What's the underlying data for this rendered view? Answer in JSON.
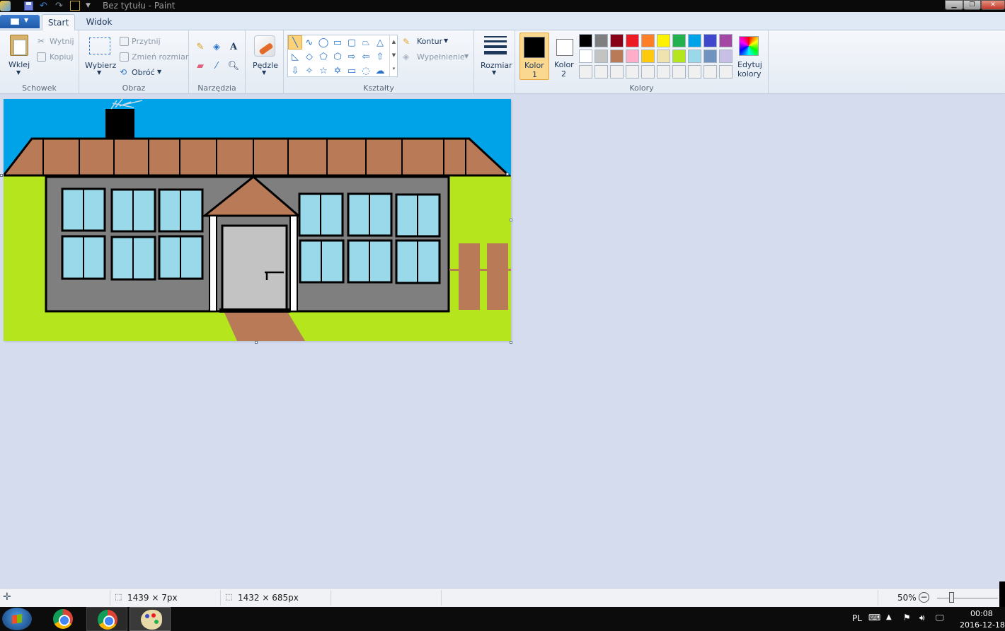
{
  "window": {
    "title": "Bez tytułu - Paint",
    "minimize": "▁",
    "maximize": "❐",
    "close": "✕"
  },
  "tabs": {
    "start": "Start",
    "view": "Widok"
  },
  "clipboard": {
    "paste": "Wklej",
    "cut": "Wytnij",
    "copy": "Kopiuj",
    "group": "Schowek"
  },
  "image": {
    "select": "Wybierz",
    "crop": "Przytnij",
    "resize": "Zmień rozmiar",
    "rotate": "Obróć",
    "group": "Obraz"
  },
  "tools": {
    "group": "Narzędzia",
    "text_glyph": "A"
  },
  "brushes": {
    "label": "Pędzle"
  },
  "shapes": {
    "group": "Kształty",
    "outline": "Kontur",
    "fill": "Wypełnienie"
  },
  "size": {
    "label": "Rozmiar"
  },
  "colors": {
    "color1_line1": "Kolor",
    "color1_line2": "1",
    "color2_line1": "Kolor",
    "color2_line2": "2",
    "edit_line1": "Edytuj",
    "edit_line2": "kolory",
    "group": "Kolory",
    "color1": "#000000",
    "color2": "#ffffff",
    "palette_row1": [
      "#000000",
      "#7f7f7f",
      "#880015",
      "#ed1c24",
      "#ff7f27",
      "#fff200",
      "#22b14c",
      "#00a2e8",
      "#3f48cc",
      "#a349a4"
    ],
    "palette_row2": [
      "#ffffff",
      "#c3c3c3",
      "#b97a57",
      "#ffaec9",
      "#ffc90e",
      "#efe4b0",
      "#b5e61d",
      "#99d9ea",
      "#7092be",
      "#c8bfe7"
    ],
    "palette_row3": [
      "#f0f0f0",
      "#f0f0f0",
      "#f0f0f0",
      "#f0f0f0",
      "#f0f0f0",
      "#f0f0f0",
      "#f0f0f0",
      "#f0f0f0",
      "#f0f0f0",
      "#f0f0f0"
    ]
  },
  "status": {
    "selection_size": "1439 × 7px",
    "image_size": "1432 × 685px",
    "zoom": "50%"
  },
  "tray": {
    "language": "PL",
    "time": "00:08",
    "date": "2016-12-18"
  }
}
